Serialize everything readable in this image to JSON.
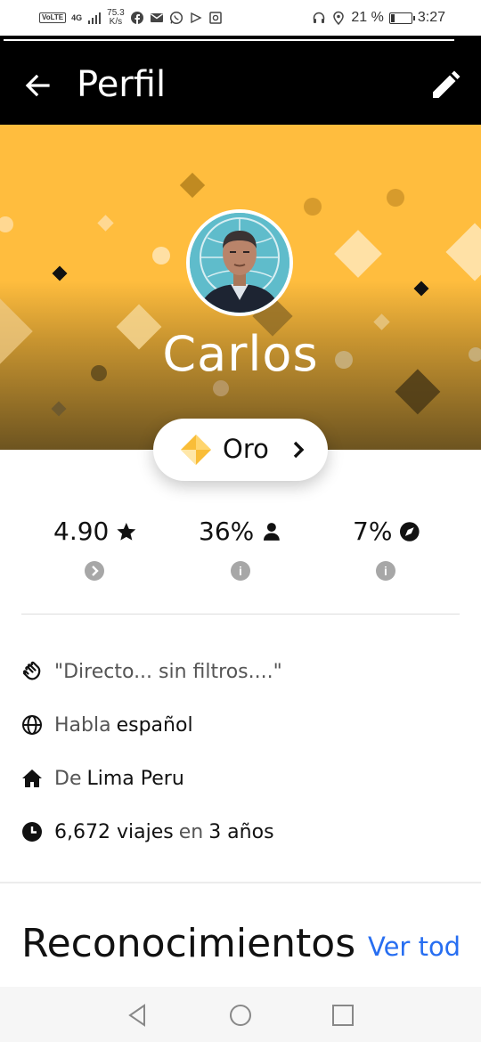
{
  "status_bar": {
    "network_badge": "VoLTE",
    "network_type": "4G",
    "speed_value": "75.3",
    "speed_unit": "K/s",
    "battery_percent": "21 %",
    "battery_level": 0.21,
    "time": "3:27"
  },
  "header": {
    "title": "Perfil"
  },
  "profile": {
    "name": "Carlos",
    "tier": "Oro"
  },
  "stats": [
    {
      "value": "4.90",
      "icon": "star-icon"
    },
    {
      "value": "36%",
      "icon": "person-icon"
    },
    {
      "value": "7%",
      "icon": "compass-icon"
    }
  ],
  "details": {
    "quote": "\"Directo... sin filtros....\"",
    "language_prefix": "Habla",
    "language": "español",
    "origin_prefix": "De",
    "origin": "Lima Peru",
    "trips": "6,672 viajes",
    "trips_connector": "en",
    "years": "3 años"
  },
  "recognitions": {
    "title": "Reconocimientos",
    "see_all": "Ver tod"
  },
  "colors": {
    "hero_yellow": "#ffbd3e",
    "hero_dark": "#6d5420",
    "link_blue": "#276ef1",
    "tier_gold": "#f9bd38"
  }
}
